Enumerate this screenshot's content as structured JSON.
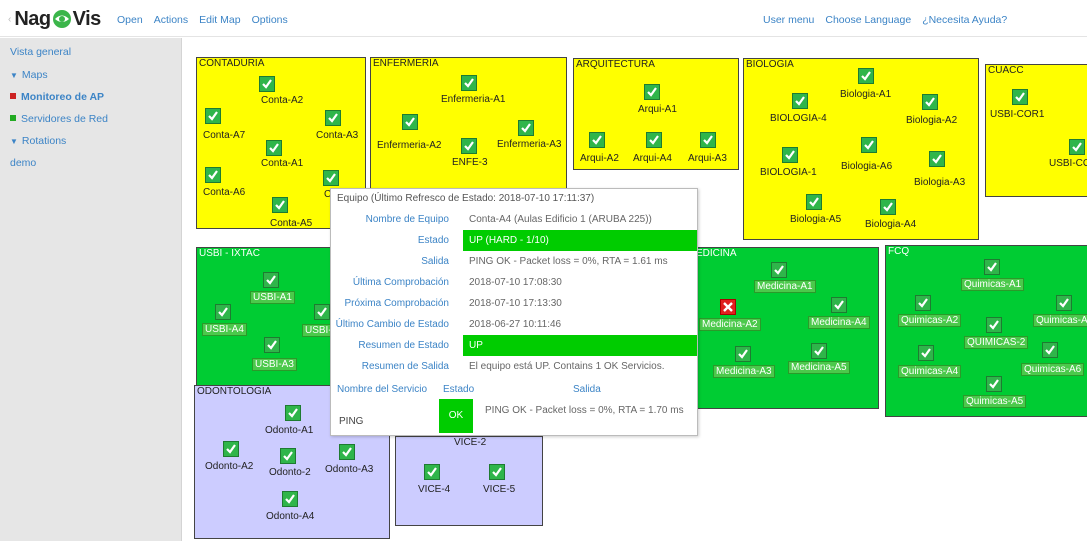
{
  "header": {
    "logo_text_a": "Nag",
    "logo_text_b": "Vis",
    "logo_icon": "eye-logo-icon",
    "left_menu": [
      "Open",
      "Actions",
      "Edit Map",
      "Options"
    ],
    "right_menu": [
      "User menu",
      "Choose Language",
      "¿Necesita Ayuda?"
    ]
  },
  "sidebar": {
    "overview": "Vista general",
    "maps_label": "Maps",
    "maps": [
      {
        "label": "Monitoreo de AP",
        "color": "#cc2222"
      },
      {
        "label": "Servidores de Red",
        "color": "#22aa22"
      }
    ],
    "rotations_label": "Rotations",
    "rotations": [
      "demo"
    ]
  },
  "colors": {
    "accent": "#3c84c6",
    "up": "#00cc00",
    "ok_icon": "#2fb54a",
    "crit_icon": "#e02020",
    "yellow_area": "#ffff00",
    "green_area": "#00cc33",
    "lavender_area": "#ccccff"
  },
  "areas": {
    "contaduria": {
      "title": "CONTADURIA",
      "nodes": [
        "Conta-A2",
        "Conta-A7",
        "Conta-A3",
        "Conta-A1",
        "Conta-A6",
        "Con",
        "Conta-A5"
      ]
    },
    "enfermeria": {
      "title": "ENFERMERIA",
      "nodes": [
        "Enfermeria-A1",
        "Enfermeria-A2",
        "Enfermeria-A3",
        "ENFE-3"
      ]
    },
    "arquitectura": {
      "title": "ARQUITECTURA",
      "nodes": [
        "Arqui-A1",
        "Arqui-A2",
        "Arqui-A4",
        "Arqui-A3"
      ]
    },
    "biologia": {
      "title": "BIOLOGIA",
      "nodes": [
        "Biologia-A1",
        "BIOLOGIA-4",
        "Biologia-A2",
        "BIOLOGIA-1",
        "Biologia-A6",
        "Biologia-A3",
        "Biologia-A5",
        "Biologia-A4"
      ]
    },
    "cuacc": {
      "title": "CUACC",
      "nodes": [
        "USBI-COR1",
        "USBI-COR"
      ]
    },
    "usbi": {
      "title": "USBI - IXTAC",
      "nodes": [
        "USBI-A1",
        "USBI-A4",
        "USBI-",
        "USBI-A3"
      ]
    },
    "medicina": {
      "title": "EDICINA",
      "nodes": [
        "Medicina-A1",
        "Medicina-A2",
        "Medicina-A4",
        "Medicina-A3",
        "Medicina-A5"
      ]
    },
    "fcq": {
      "title": "FCQ",
      "nodes": [
        "Quimicas-A1",
        "Quimicas-A2",
        "Quimicas-A",
        "QUIMICAS-2",
        "Quimicas-A4",
        "Quimicas-A6",
        "Quimicas-A5"
      ]
    },
    "odontologia": {
      "title": "ODONTOLOGIA",
      "nodes": [
        "Odonto-A1",
        "Odonto-A2",
        "Odonto-2",
        "Odonto-A3",
        "Odonto-A4"
      ]
    },
    "vice": {
      "title": "",
      "nodes": [
        "VICE-2",
        "VICE-4",
        "VICE-5"
      ]
    }
  },
  "popup": {
    "title": "Equipo (Último Refresco de Estado: 2018-07-10 17:11:37)",
    "rows": [
      {
        "k": "Nombre de Equipo",
        "v": "Conta-A4 (Aulas Edificio 1 (ARUBA 225))"
      },
      {
        "k": "Estado",
        "v": "UP (HARD - 1/10)"
      },
      {
        "k": "Salida",
        "v": "PING OK - Packet loss = 0%, RTA = 1.61 ms"
      },
      {
        "k": "Última Comprobación",
        "v": "2018-07-10 17:08:30"
      },
      {
        "k": "Próxima Comprobación",
        "v": "2018-07-10 17:13:30"
      },
      {
        "k": "Último Cambio de Estado",
        "v": "2018-06-27 10:11:46"
      },
      {
        "k": "Resumen de Estado",
        "v": "UP"
      },
      {
        "k": "Resumen de Salida",
        "v": "El equipo está UP. Contains 1 OK Servicios."
      }
    ],
    "svc_head": {
      "name": "Nombre del Servicio",
      "state": "Estado",
      "output": "Salida"
    },
    "service": {
      "name": "PING",
      "state": "OK",
      "output": "PING OK - Packet loss = 0%, RTA = 1.70 ms"
    }
  }
}
